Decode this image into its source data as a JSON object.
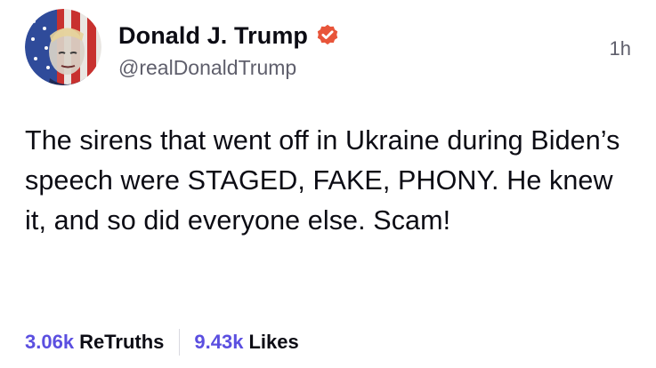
{
  "post": {
    "author": {
      "display_name": "Donald J. Trump",
      "handle": "@realDonaldTrump",
      "verified_icon": "verified-badge-icon",
      "avatar_icon": "profile-avatar"
    },
    "time_ago": "1h",
    "text": "The sirens that went off in Ukraine during Biden’s speech were STAGED, FAKE, PHONY. He knew it, and so did everyone else. Scam!",
    "stats": {
      "retruths_count": "3.06k",
      "retruths_label": "ReTruths",
      "likes_count": "9.43k",
      "likes_label": "Likes"
    }
  },
  "colors": {
    "accent": "#5b4fe0",
    "verified_badge": "#e8553a",
    "text_primary": "#0c0c14",
    "text_secondary": "#5f5f6c"
  }
}
